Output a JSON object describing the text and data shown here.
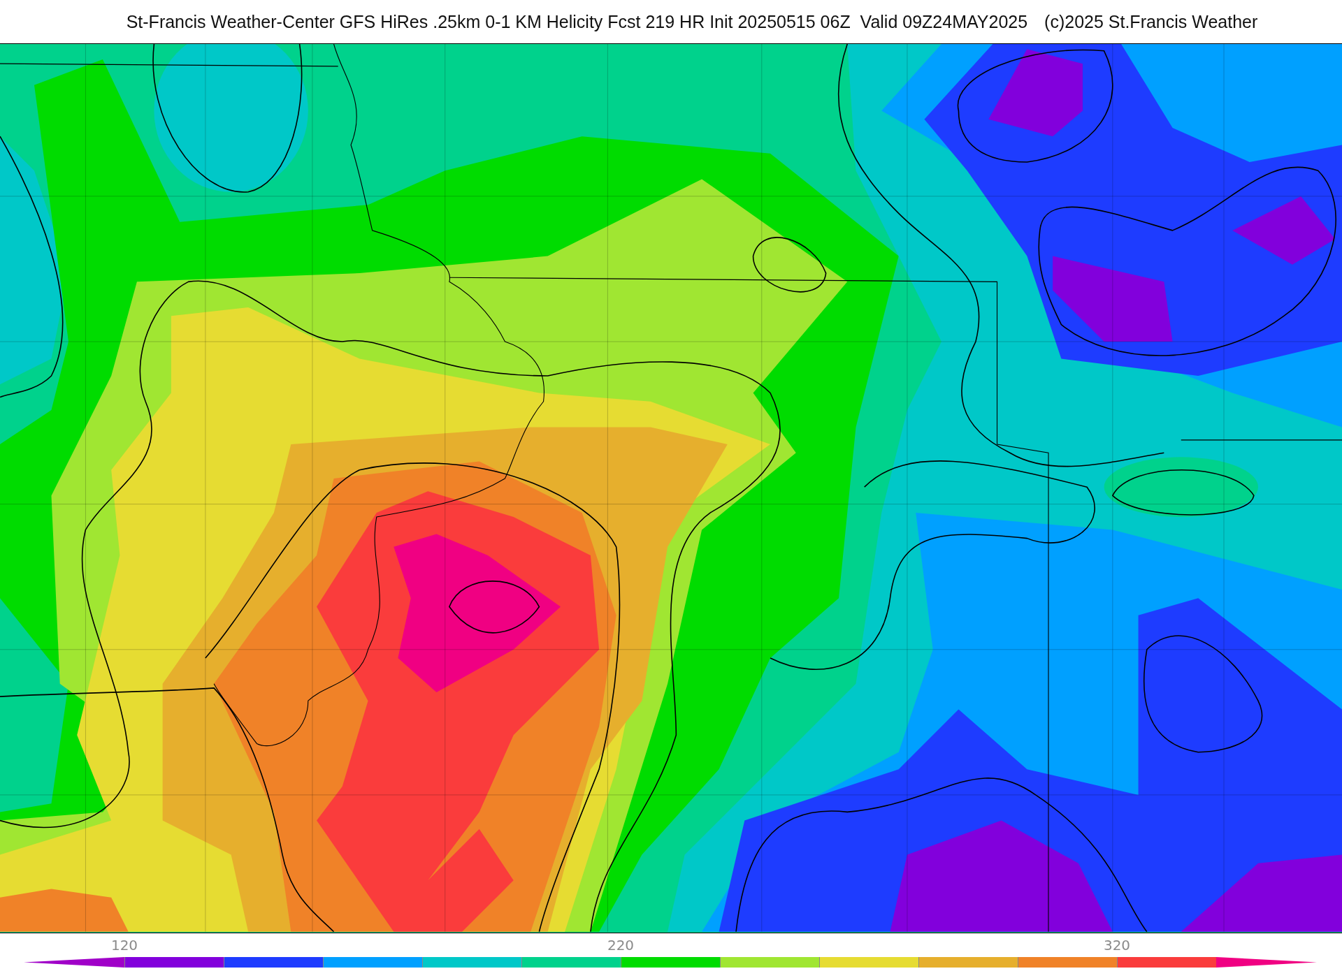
{
  "header": {
    "title": "St-Francis Weather-Center GFS HiRes .25km 0-1 KM Helicity Fcst 219 HR Init 20250515 06Z  Valid 09Z24MAY2025",
    "credit": "(c)2025 St.Francis Weather"
  },
  "colorbar": {
    "labels": [
      "120",
      "220",
      "320"
    ],
    "bins": [
      {
        "kind": "low-end",
        "color": "#a000c8"
      },
      {
        "kind": "bin",
        "color": "#8200dc"
      },
      {
        "kind": "bin",
        "color": "#1e3cff"
      },
      {
        "kind": "bin",
        "color": "#00a0ff"
      },
      {
        "kind": "bin",
        "color": "#00c8c8"
      },
      {
        "kind": "bin",
        "color": "#00d28c"
      },
      {
        "kind": "bin",
        "color": "#00dc00"
      },
      {
        "kind": "bin",
        "color": "#a0e632"
      },
      {
        "kind": "bin",
        "color": "#e6dc32"
      },
      {
        "kind": "bin",
        "color": "#e6af2d"
      },
      {
        "kind": "bin",
        "color": "#f08228"
      },
      {
        "kind": "bin",
        "color": "#fa3c3c"
      },
      {
        "kind": "high-end",
        "color": "#f00082"
      }
    ]
  }
}
